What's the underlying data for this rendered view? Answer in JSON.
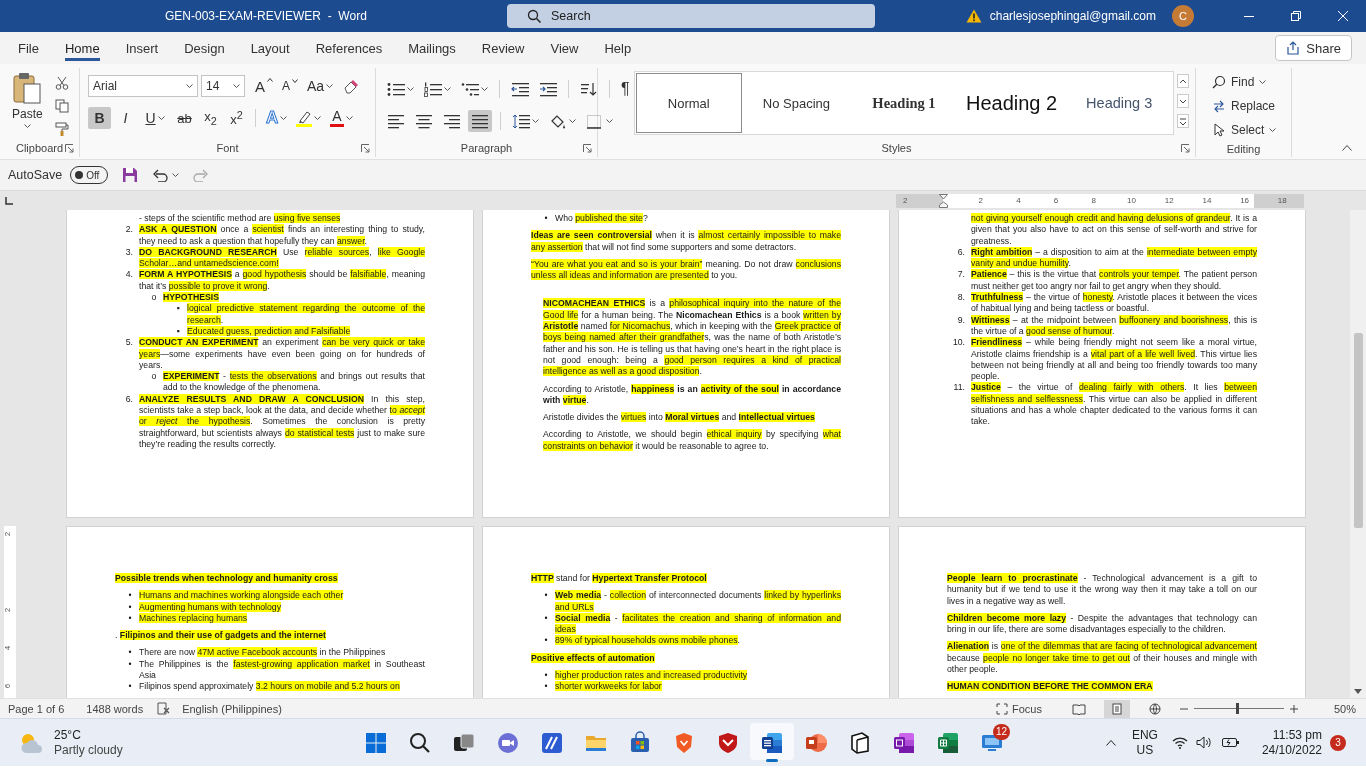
{
  "window": {
    "title": "GEN-003-EXAM-REVIEWER  -  Word",
    "search": {
      "placeholder": "Search"
    },
    "account": "charlesjosephingal@gmail.com",
    "avatar": "C"
  },
  "ribbon_tabs": [
    {
      "label": "File",
      "selected": false
    },
    {
      "label": "Home",
      "selected": true
    },
    {
      "label": "Insert",
      "selected": false
    },
    {
      "label": "Design",
      "selected": false
    },
    {
      "label": "Layout",
      "selected": false
    },
    {
      "label": "References",
      "selected": false
    },
    {
      "label": "Mailings",
      "selected": false
    },
    {
      "label": "Review",
      "selected": false
    },
    {
      "label": "View",
      "selected": false
    },
    {
      "label": "Help",
      "selected": false
    }
  ],
  "share": "Share",
  "ribbon": {
    "clipboard": {
      "label": "Clipboard",
      "paste": "Paste"
    },
    "font": {
      "label": "Font",
      "name": "Arial",
      "size": "14",
      "tools": [
        {
          "kind": "grow",
          "label": "A"
        },
        {
          "kind": "shrink",
          "label": "A"
        },
        {
          "kind": "case",
          "label": "Aa"
        },
        {
          "kind": "clear"
        }
      ],
      "format": [
        {
          "kind": "bold",
          "label": "B",
          "selected": true
        },
        {
          "kind": "italic",
          "label": "I",
          "selected": false
        },
        {
          "kind": "underline",
          "label": "U",
          "selected": false
        },
        {
          "kind": "strike",
          "label": "ab",
          "selected": false
        },
        {
          "kind": "sub",
          "label": "x$_{2}$",
          "selected": false
        },
        {
          "kind": "sup",
          "label": "x$^{2}$",
          "selected": false
        }
      ],
      "color_tools": [
        {
          "kind": "effects",
          "label": "A"
        },
        {
          "kind": "highlight"
        },
        {
          "kind": "color",
          "label": "A"
        }
      ]
    },
    "paragraph": {
      "label": "Paragraph",
      "list_tools": [
        {
          "kind": "bullets"
        },
        {
          "kind": "numbering"
        },
        {
          "kind": "multilevel"
        },
        {
          "kind": "outdent"
        },
        {
          "kind": "indent"
        },
        {
          "kind": "sort"
        },
        {
          "kind": "marks",
          "label": "¶"
        }
      ],
      "align": [
        {
          "kind": "left",
          "selected": false
        },
        {
          "kind": "center",
          "selected": false
        },
        {
          "kind": "right",
          "selected": false
        },
        {
          "kind": "justify",
          "selected": true
        }
      ],
      "fill_tools": [
        {
          "kind": "spacing"
        },
        {
          "kind": "shading"
        },
        {
          "kind": "borders"
        }
      ]
    },
    "styles": {
      "label": "Styles",
      "items": [
        {
          "kind": "normal",
          "label": "Normal",
          "selected": true
        },
        {
          "kind": "nospacing",
          "label": "No Spacing",
          "selected": false
        },
        {
          "kind": "h1",
          "label": "Heading 1",
          "selected": false
        },
        {
          "kind": "h2",
          "label": "Heading 2",
          "selected": false
        },
        {
          "kind": "h3",
          "label": "Heading 3",
          "selected": false
        }
      ]
    },
    "editing": {
      "label": "Editing",
      "items": [
        {
          "kind": "find",
          "label": "Find"
        },
        {
          "kind": "replace",
          "label": "Replace"
        },
        {
          "kind": "select",
          "label": "Select"
        }
      ]
    }
  },
  "quick_access": {
    "autosave": {
      "label": "AutoSave",
      "state": "Off",
      "on": false
    },
    "redo": {
      "disabled": true
    }
  },
  "ruler": {
    "labels": [
      "2",
      "2",
      "4",
      "6",
      "8",
      "10",
      "12",
      "14",
      "16",
      "18"
    ]
  },
  "vertical_ruler": {
    "labels": [
      "2",
      "2",
      "4",
      "6"
    ]
  },
  "pages": [
    {
      "blocks": [
        {
          "kind": "continuation",
          "runs": [
            {
              "text": "- steps of the scientific method are ",
              "highlighted": false
            },
            {
              "text": "using five senses",
              "highlighted": true
            }
          ]
        },
        {
          "kind": "numbered",
          "marker": "2.",
          "runs": [
            {
              "text": "**ASK A QUESTION**",
              "highlighted": true
            },
            {
              "text": " once a ",
              "highlighted": false
            },
            {
              "text": "scientist",
              "highlighted": true
            },
            {
              "text": " finds an interesting thing to study, they need to ask a question that hopefully they can ",
              "highlighted": false
            },
            {
              "text": "answer",
              "highlighted": true
            },
            {
              "text": ".",
              "highlighted": false
            }
          ]
        },
        {
          "kind": "numbered",
          "marker": "3.",
          "runs": [
            {
              "text": "**DO BACKGROUND RESEARCH**",
              "highlighted": true
            },
            {
              "text": " Use ",
              "highlighted": false
            },
            {
              "text": "reliable sources",
              "highlighted": true
            },
            {
              "text": ", ",
              "highlighted": false
            },
            {
              "text": "like Google Scholar…and untamedscience.com!",
              "highlighted": true
            }
          ]
        },
        {
          "kind": "numbered",
          "marker": "4.",
          "runs": [
            {
              "text": "**FORM A HYPOTHESIS**",
              "highlighted": true
            },
            {
              "text": " a ",
              "highlighted": false
            },
            {
              "text": "good hypothesis",
              "highlighted": true
            },
            {
              "text": " should be ",
              "highlighted": false
            },
            {
              "text": "falsifiable",
              "highlighted": true
            },
            {
              "text": ", meaning that it’s ",
              "highlighted": false
            },
            {
              "text": "possible to prove it wrong",
              "highlighted": true
            },
            {
              "text": ".",
              "highlighted": false
            }
          ],
          "children": [
            {
              "kind": "bullet",
              "marker": "o",
              "runs": [
                {
                  "text": "**HYPOTHESIS**",
                  "highlighted": true
                }
              ],
              "children": [
                {
                  "kind": "bullet",
                  "marker": "▪",
                  "runs": [
                    {
                      "text": "logical predictive statement regarding the outcome of the research",
                      "highlighted": true
                    },
                    {
                      "text": ".",
                      "highlighted": false
                    }
                  ]
                },
                {
                  "kind": "bullet",
                  "marker": "▪",
                  "runs": [
                    {
                      "text": "Educated guess, prediction and Falsifiable",
                      "highlighted": true
                    }
                  ]
                }
              ]
            }
          ]
        },
        {
          "kind": "numbered",
          "marker": "5.",
          "runs": [
            {
              "text": "**CONDUCT AN EXPERIMENT**",
              "highlighted": true
            },
            {
              "text": " an experiment ",
              "highlighted": false
            },
            {
              "text": "can be very quick or take years",
              "highlighted": true
            },
            {
              "text": "—some experiments have even been going on for hundreds of years.",
              "highlighted": false
            }
          ],
          "children": [
            {
              "kind": "bullet",
              "marker": "o",
              "runs": [
                {
                  "text": "**EXPERIMENT**",
                  "highlighted": true
                },
                {
                  "text": " - ",
                  "highlighted": false
                },
                {
                  "text": "tests the observations",
                  "highlighted": true
                },
                {
                  "text": " and brings out results that add to the knowledge of the phenomena.",
                  "highlighted": false
                }
              ]
            }
          ]
        },
        {
          "kind": "numbered",
          "marker": "6.",
          "runs": [
            {
              "text": "**ANALYZE RESULTS AND DRAW A CONCLUSION**",
              "highlighted": true
            },
            {
              "text": " In this step, scientists take a step back, look at the data, and decide whether ",
              "highlighted": false
            },
            {
              "text": "to *accept* or *reject* the hypothesis",
              "highlighted": true
            },
            {
              "text": ". Sometimes the conclusion is pretty straightforward, but scientists always ",
              "highlighted": false
            },
            {
              "text": "do statistical tests",
              "highlighted": true
            },
            {
              "text": " just to make sure they’re reading the results correctly.",
              "highlighted": false
            }
          ]
        }
      ]
    },
    {
      "blocks": [
        {
          "kind": "bullet",
          "marker": "•",
          "runs": [
            {
              "text": "Who ",
              "highlighted": false
            },
            {
              "text": "published the site",
              "highlighted": true
            },
            {
              "text": "?",
              "highlighted": false
            }
          ]
        },
        {
          "kind": "para",
          "runs": [
            {
              "text": "**Ideas are seen controversial**",
              "highlighted": true
            },
            {
              "text": " when it is ",
              "highlighted": false
            },
            {
              "text": "almost certainly impossible to make any assertion",
              "highlighted": true
            },
            {
              "text": " that will not find some supporters and some detractors.",
              "highlighted": false
            }
          ]
        },
        {
          "kind": "para",
          "runs": [
            {
              "text": "“You are what you eat and so is your brain”",
              "highlighted": true
            },
            {
              "text": " meaning. Do not draw ",
              "highlighted": false
            },
            {
              "text": "conclusions unless all ideas and information are presented",
              "highlighted": true
            },
            {
              "text": " to you.",
              "highlighted": false
            }
          ]
        },
        {
          "kind": "inset",
          "runs": [
            {
              "text": "**NICOMACHEAN ETHICS**",
              "highlighted": true
            },
            {
              "text": " is a ",
              "highlighted": false
            },
            {
              "text": "philosophical inquiry into the nature of the Good life",
              "highlighted": true
            },
            {
              "text": " for a human being. The **Nicomachean Ethics** is a book ",
              "highlighted": false
            },
            {
              "text": "written by **Aristotle**",
              "highlighted": true
            },
            {
              "text": " named ",
              "highlighted": false
            },
            {
              "text": "for Nicomachus",
              "highlighted": true
            },
            {
              "text": ", which in keeping with the ",
              "highlighted": false
            },
            {
              "text": "Greek practice of boys being named after their grandfather",
              "highlighted": true
            },
            {
              "text": "s, was the name of both Aristotle’s father and his son. He is telling us that having one’s heart in the right place is not good enough: being a ",
              "highlighted": false
            },
            {
              "text": "good person requires a kind of practical intelligence as well as a good disposition",
              "highlighted": true
            },
            {
              "text": ".",
              "highlighted": false
            }
          ]
        },
        {
          "kind": "inset",
          "runs": [
            {
              "text": "According to Aristotle, ",
              "highlighted": false
            },
            {
              "text": "**happiness**",
              "highlighted": true
            },
            {
              "text": " **is an** ",
              "highlighted": false
            },
            {
              "text": "**activity of the soul**",
              "highlighted": true
            },
            {
              "text": " **in accordance with** ",
              "highlighted": false
            },
            {
              "text": "**virtue**",
              "highlighted": true
            },
            {
              "text": ".",
              "highlighted": false
            }
          ]
        },
        {
          "kind": "inset",
          "runs": [
            {
              "text": "Aristotle divides the ",
              "highlighted": false
            },
            {
              "text": "virtues",
              "highlighted": true
            },
            {
              "text": " into ",
              "highlighted": false
            },
            {
              "text": "**Moral virtues**",
              "highlighted": true
            },
            {
              "text": " and ",
              "highlighted": false
            },
            {
              "text": "**Intellectual virtues**",
              "highlighted": true
            }
          ]
        },
        {
          "kind": "inset",
          "runs": [
            {
              "text": "According to Aristotle, we should begin ",
              "highlighted": false
            },
            {
              "text": "ethical inquiry",
              "highlighted": true
            },
            {
              "text": " by specifying ",
              "highlighted": false
            },
            {
              "text": "what constraints on behavior",
              "highlighted": true
            },
            {
              "text": " it would be reasonable to agree to.",
              "highlighted": false
            }
          ]
        }
      ]
    },
    {
      "blocks": [
        {
          "kind": "continuation",
          "runs": [
            {
              "text": "not giving yourself enough credit and having delusions of grandeur",
              "highlighted": true
            },
            {
              "text": ". It is a given that you also have to act on this sense of self-worth and strive for greatness.",
              "highlighted": false
            }
          ]
        },
        {
          "kind": "numbered",
          "marker": "6.",
          "runs": [
            {
              "text": "**Right ambition**",
              "highlighted": true
            },
            {
              "text": " – a disposition to aim at the ",
              "highlighted": false
            },
            {
              "text": "intermediate between empty vanity and undue humility",
              "highlighted": true
            },
            {
              "text": ".",
              "highlighted": false
            }
          ]
        },
        {
          "kind": "numbered",
          "marker": "7.",
          "runs": [
            {
              "text": "**Patience**",
              "highlighted": true
            },
            {
              "text": " – this is the virtue that ",
              "highlighted": false
            },
            {
              "text": "controls your temper",
              "highlighted": true
            },
            {
              "text": ". The patient person must neither get too angry nor fail to get angry when they should.",
              "highlighted": false
            }
          ]
        },
        {
          "kind": "numbered",
          "marker": "8.",
          "runs": [
            {
              "text": "**Truthfulness**",
              "highlighted": true
            },
            {
              "text": " – the virtue of ",
              "highlighted": false
            },
            {
              "text": "honesty",
              "highlighted": true
            },
            {
              "text": ". Aristotle places it between the vices of habitual lying and being tactless or boastful.",
              "highlighted": false
            }
          ]
        },
        {
          "kind": "numbered",
          "marker": "9.",
          "runs": [
            {
              "text": "**Wittiness**",
              "highlighted": true
            },
            {
              "text": " – at the midpoint between ",
              "highlighted": false
            },
            {
              "text": "buffoonery and boorishness",
              "highlighted": true
            },
            {
              "text": ", this is the virtue of a ",
              "highlighted": false
            },
            {
              "text": "good sense of humour",
              "highlighted": true
            },
            {
              "text": ".",
              "highlighted": false
            }
          ]
        },
        {
          "kind": "numbered",
          "marker": "10.",
          "runs": [
            {
              "text": "**Friendliness**",
              "highlighted": true
            },
            {
              "text": " – while being friendly might not seem like a moral virtue, Aristotle claims friendship is a ",
              "highlighted": false
            },
            {
              "text": "vital part of a life well lived",
              "highlighted": true
            },
            {
              "text": ". This virtue lies between not being friendly at all and being too friendly towards too many people.",
              "highlighted": false
            }
          ]
        },
        {
          "kind": "numbered",
          "marker": "11.",
          "runs": [
            {
              "text": "**Justice**",
              "highlighted": true
            },
            {
              "text": " – the virtue of ",
              "highlighted": false
            },
            {
              "text": "dealing fairly with others",
              "highlighted": true
            },
            {
              "text": ". It lies ",
              "highlighted": false
            },
            {
              "text": "between selfishness and selflessness",
              "highlighted": true
            },
            {
              "text": ". This virtue can also be applied in different situations and has a whole chapter dedicated to the various forms it can take.",
              "highlighted": false
            }
          ]
        }
      ]
    },
    {
      "blocks": [
        {
          "kind": "para",
          "runs": [
            {
              "text": "**Possible trends when technology and humanity cross**",
              "highlighted": true
            }
          ]
        },
        {
          "kind": "bullet",
          "marker": "•",
          "runs": [
            {
              "text": "Humans and machines working alongside each other",
              "highlighted": true
            }
          ]
        },
        {
          "kind": "bullet",
          "marker": "•",
          "runs": [
            {
              "text": "Augmenting humans with technology",
              "highlighted": true
            }
          ]
        },
        {
          "kind": "bullet",
          "marker": "•",
          "runs": [
            {
              "text": "Machines replacing humans",
              "highlighted": true
            }
          ]
        },
        {
          "kind": "para",
          "runs": [
            {
              "text": ". ",
              "highlighted": false
            },
            {
              "text": "**Filipinos and their use of gadgets and the internet**",
              "highlighted": true
            }
          ]
        },
        {
          "kind": "bullet",
          "marker": "•",
          "runs": [
            {
              "text": "There are now ",
              "highlighted": false
            },
            {
              "text": "47M active Facebook accounts",
              "highlighted": true
            },
            {
              "text": " in the Philippines",
              "highlighted": false
            }
          ]
        },
        {
          "kind": "bullet",
          "marker": "•",
          "runs": [
            {
              "text": "The Philippines is the ",
              "highlighted": false
            },
            {
              "text": "fastest-growing application market",
              "highlighted": true
            },
            {
              "text": " in Southeast Asia",
              "highlighted": false
            }
          ]
        },
        {
          "kind": "bullet",
          "marker": "•",
          "runs": [
            {
              "text": "Filipinos spend approximately ",
              "highlighted": false
            },
            {
              "text": "3.2 hours on mobile and 5.2 hours on",
              "highlighted": true
            }
          ]
        }
      ]
    },
    {
      "blocks": [
        {
          "kind": "para",
          "runs": [
            {
              "text": "**HTTP**",
              "highlighted": true
            },
            {
              "text": " stand for ",
              "highlighted": false
            },
            {
              "text": "**Hypertext Transfer Protocol**",
              "highlighted": true
            }
          ]
        },
        {
          "kind": "bullet",
          "marker": "•",
          "runs": [
            {
              "text": "**Web media**",
              "highlighted": true
            },
            {
              "text": " - ",
              "highlighted": false
            },
            {
              "text": "collection",
              "highlighted": true
            },
            {
              "text": " of interconnected documents ",
              "highlighted": false
            },
            {
              "text": "linked by hyperlinks and URLs",
              "highlighted": true
            }
          ]
        },
        {
          "kind": "bullet",
          "marker": "•",
          "runs": [
            {
              "text": "**Social media**",
              "highlighted": true
            },
            {
              "text": " - ",
              "highlighted": false
            },
            {
              "text": "facilitates the creation and sharing of information and ideas",
              "highlighted": true
            }
          ]
        },
        {
          "kind": "bullet",
          "marker": "•",
          "runs": [
            {
              "text": "89% of typical households owns mobile phones",
              "highlighted": true
            },
            {
              "text": ".",
              "highlighted": false
            }
          ]
        },
        {
          "kind": "para",
          "runs": [
            {
              "text": "**Positive effects of automation**",
              "highlighted": true
            }
          ]
        },
        {
          "kind": "bullet",
          "marker": "•",
          "runs": [
            {
              "text": "higher production rates and increased productivity",
              "highlighted": true
            }
          ]
        },
        {
          "kind": "bullet",
          "marker": "•",
          "runs": [
            {
              "text": "shorter workweeks for labor",
              "highlighted": true
            }
          ]
        }
      ]
    },
    {
      "blocks": [
        {
          "kind": "para",
          "runs": [
            {
              "text": "**People learn to procrastinate**",
              "highlighted": true
            },
            {
              "text": " - Technological advancement is a gift to humanity but if we tend to use it the wrong way then it may take a toll on our lives in a negative way as well.",
              "highlighted": false
            }
          ]
        },
        {
          "kind": "para",
          "runs": [
            {
              "text": "**Children become more lazy**",
              "highlighted": true
            },
            {
              "text": " - Despite the advantages that technology can bring in our life, there are some disadvantages especially to the children.",
              "highlighted": false
            }
          ]
        },
        {
          "kind": "para",
          "runs": [
            {
              "text": "**Alienation**",
              "highlighted": true
            },
            {
              "text": " is ",
              "highlighted": false
            },
            {
              "text": "one of the dilemmas that are facing of technological advancement",
              "highlighted": true
            },
            {
              "text": " because ",
              "highlighted": false
            },
            {
              "text": "people no longer take time to get out",
              "highlighted": true
            },
            {
              "text": " of their houses and mingle with other people.",
              "highlighted": false
            }
          ]
        },
        {
          "kind": "para",
          "runs": [
            {
              "text": "**HUMAN CONDITION BEFORE THE COMMON ERA**",
              "highlighted": true
            }
          ]
        }
      ]
    }
  ],
  "status_bar": {
    "page": "Page 1 of 6",
    "words": "1488 words",
    "language": "English (Philippines)",
    "focus": "Focus",
    "views": [
      {
        "kind": "read",
        "selected": false
      },
      {
        "kind": "print",
        "selected": true
      },
      {
        "kind": "web",
        "selected": false
      }
    ],
    "zoom": {
      "level": 0.48,
      "label": "50%"
    }
  },
  "taskbar": {
    "weather": {
      "temperature": "25°C",
      "condition": "Partly cloudy"
    },
    "apps": [
      {
        "kind": "start",
        "selected": false
      },
      {
        "kind": "search",
        "selected": false
      },
      {
        "kind": "taskview",
        "selected": false
      },
      {
        "kind": "chat",
        "selected": false
      },
      {
        "kind": "slash",
        "selected": false
      },
      {
        "kind": "folder",
        "selected": false
      },
      {
        "kind": "store",
        "selected": false
      },
      {
        "kind": "browser",
        "selected": false
      },
      {
        "kind": "security",
        "selected": false
      },
      {
        "kind": "word",
        "selected": true
      },
      {
        "kind": "slides",
        "selected": false
      },
      {
        "kind": "cube",
        "selected": false
      },
      {
        "kind": "notes",
        "selected": false
      },
      {
        "kind": "sheets",
        "selected": false
      },
      {
        "kind": "monitor",
        "selected": false,
        "badge": "12"
      }
    ],
    "language": "ENG",
    "region": "US",
    "time": "11:53 pm",
    "date": "24/10/2022",
    "notifications": "3"
  }
}
